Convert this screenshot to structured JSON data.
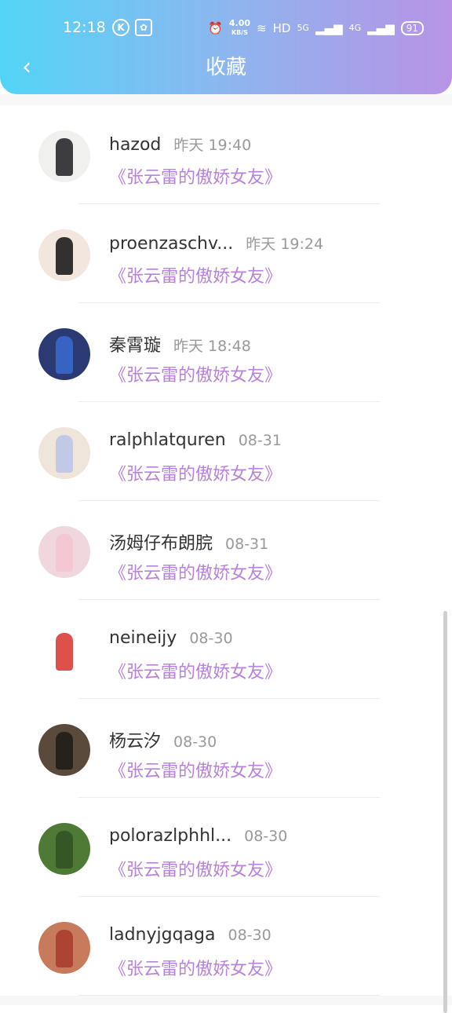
{
  "status_bar": {
    "time": "12:18",
    "k_icon": "K",
    "paw_icon": "paw-icon",
    "speed": "4.00",
    "speed_unit": "KB/S",
    "hd": "HD",
    "net5g": "5G",
    "net4g": "4G",
    "battery": "91"
  },
  "header": {
    "title": "收藏",
    "back_icon": "back-arrow-icon"
  },
  "items": [
    {
      "name": "hazod",
      "time": "昨天 19:40",
      "book": "《张云雷的傲娇女友》",
      "avatar_bg": "#f0f0ee",
      "fig": "#1c1c22"
    },
    {
      "name": "proenzaschv...",
      "time": "昨天 19:24",
      "book": "《张云雷的傲娇女友》",
      "avatar_bg": "#f3e6de",
      "fig": "#111111"
    },
    {
      "name": "秦霄璇",
      "time": "昨天 18:48",
      "book": "《张云雷的傲娇女友》",
      "avatar_bg": "#2b3a73",
      "fig": "#3a6bd0"
    },
    {
      "name": "ralphlatquren",
      "time": "08-31",
      "book": "《张云雷的傲娇女友》",
      "avatar_bg": "#efe5da",
      "fig": "#b8c4e8"
    },
    {
      "name": "汤姆仔布朗脘",
      "time": "08-31",
      "book": "《张云雷的傲娇女友》",
      "avatar_bg": "#f0d6dd",
      "fig": "#f5c6d0"
    },
    {
      "name": "neineijy",
      "time": "08-30",
      "book": "《张云雷的傲娇女友》",
      "avatar_bg": "#ffffff",
      "fig": "#d8332b"
    },
    {
      "name": "杨云汐",
      "time": "08-30",
      "book": "《张云雷的傲娇女友》",
      "avatar_bg": "#5a4a3c",
      "fig": "#1f1a16"
    },
    {
      "name": "polorazlphhl...",
      "time": "08-30",
      "book": "《张云雷的傲娇女友》",
      "avatar_bg": "#4f7a35",
      "fig": "#2f5122"
    },
    {
      "name": "ladnyjgqaga",
      "time": "08-30",
      "book": "《张云雷的傲娇女友》",
      "avatar_bg": "#c77a5c",
      "fig": "#a7392c"
    }
  ]
}
